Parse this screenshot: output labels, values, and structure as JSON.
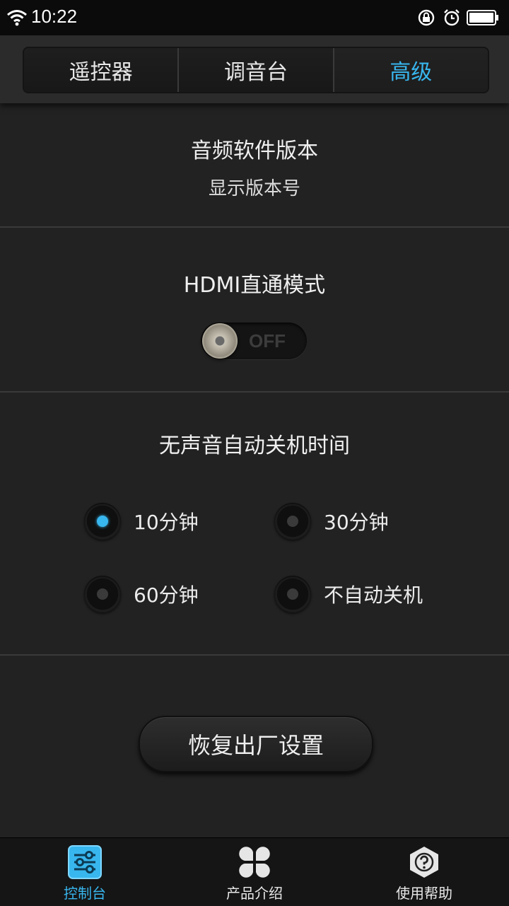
{
  "status_bar": {
    "time": "10:22"
  },
  "tabs": [
    {
      "label": "遥控器",
      "active": false
    },
    {
      "label": "调音台",
      "active": false
    },
    {
      "label": "高级",
      "active": true
    }
  ],
  "audio_version": {
    "title": "音频软件版本",
    "value": "显示版本号"
  },
  "hdmi": {
    "title": "HDMI直通模式",
    "toggle_label": "OFF"
  },
  "auto_off": {
    "title": "无声音自动关机时间",
    "options": [
      {
        "label": "10分钟",
        "selected": true
      },
      {
        "label": "30分钟",
        "selected": false
      },
      {
        "label": "60分钟",
        "selected": false
      },
      {
        "label": "不自动关机",
        "selected": false
      }
    ]
  },
  "reset_button": "恢复出厂设置",
  "bottom_nav": [
    {
      "label": "控制台",
      "icon": "sliders-icon",
      "active": true
    },
    {
      "label": "产品介绍",
      "icon": "clover-icon",
      "active": false
    },
    {
      "label": "使用帮助",
      "icon": "help-icon",
      "active": false
    }
  ],
  "colors": {
    "accent": "#38b6ee",
    "background": "#222222"
  }
}
